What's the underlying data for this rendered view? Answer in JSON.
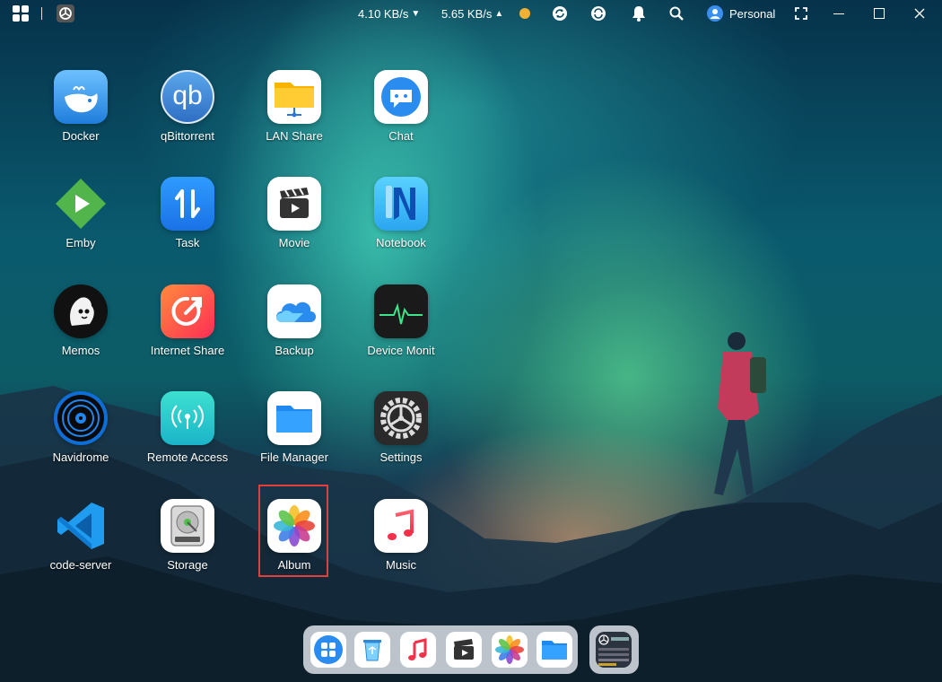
{
  "topbar": {
    "download_speed": "4.10 KB/s",
    "upload_speed": "5.65 KB/s",
    "user_label": "Personal"
  },
  "apps": [
    {
      "label": "Docker"
    },
    {
      "label": "qBittorrent",
      "icon_text": "qb"
    },
    {
      "label": "LAN Share"
    },
    {
      "label": "Chat"
    },
    {
      "label": "Emby"
    },
    {
      "label": "Task"
    },
    {
      "label": "Movie"
    },
    {
      "label": "Notebook"
    },
    {
      "label": "Memos"
    },
    {
      "label": "Internet Share"
    },
    {
      "label": "Backup"
    },
    {
      "label": "Device Monit"
    },
    {
      "label": "Navidrome"
    },
    {
      "label": "Remote Access"
    },
    {
      "label": "File Manager"
    },
    {
      "label": "Settings"
    },
    {
      "label": "code-server"
    },
    {
      "label": "Storage"
    },
    {
      "label": "Album"
    },
    {
      "label": "Music"
    }
  ],
  "selected_app": "Album",
  "colors": {
    "selection_border": "#e0403a",
    "accent_blue": "#1a8cff"
  }
}
